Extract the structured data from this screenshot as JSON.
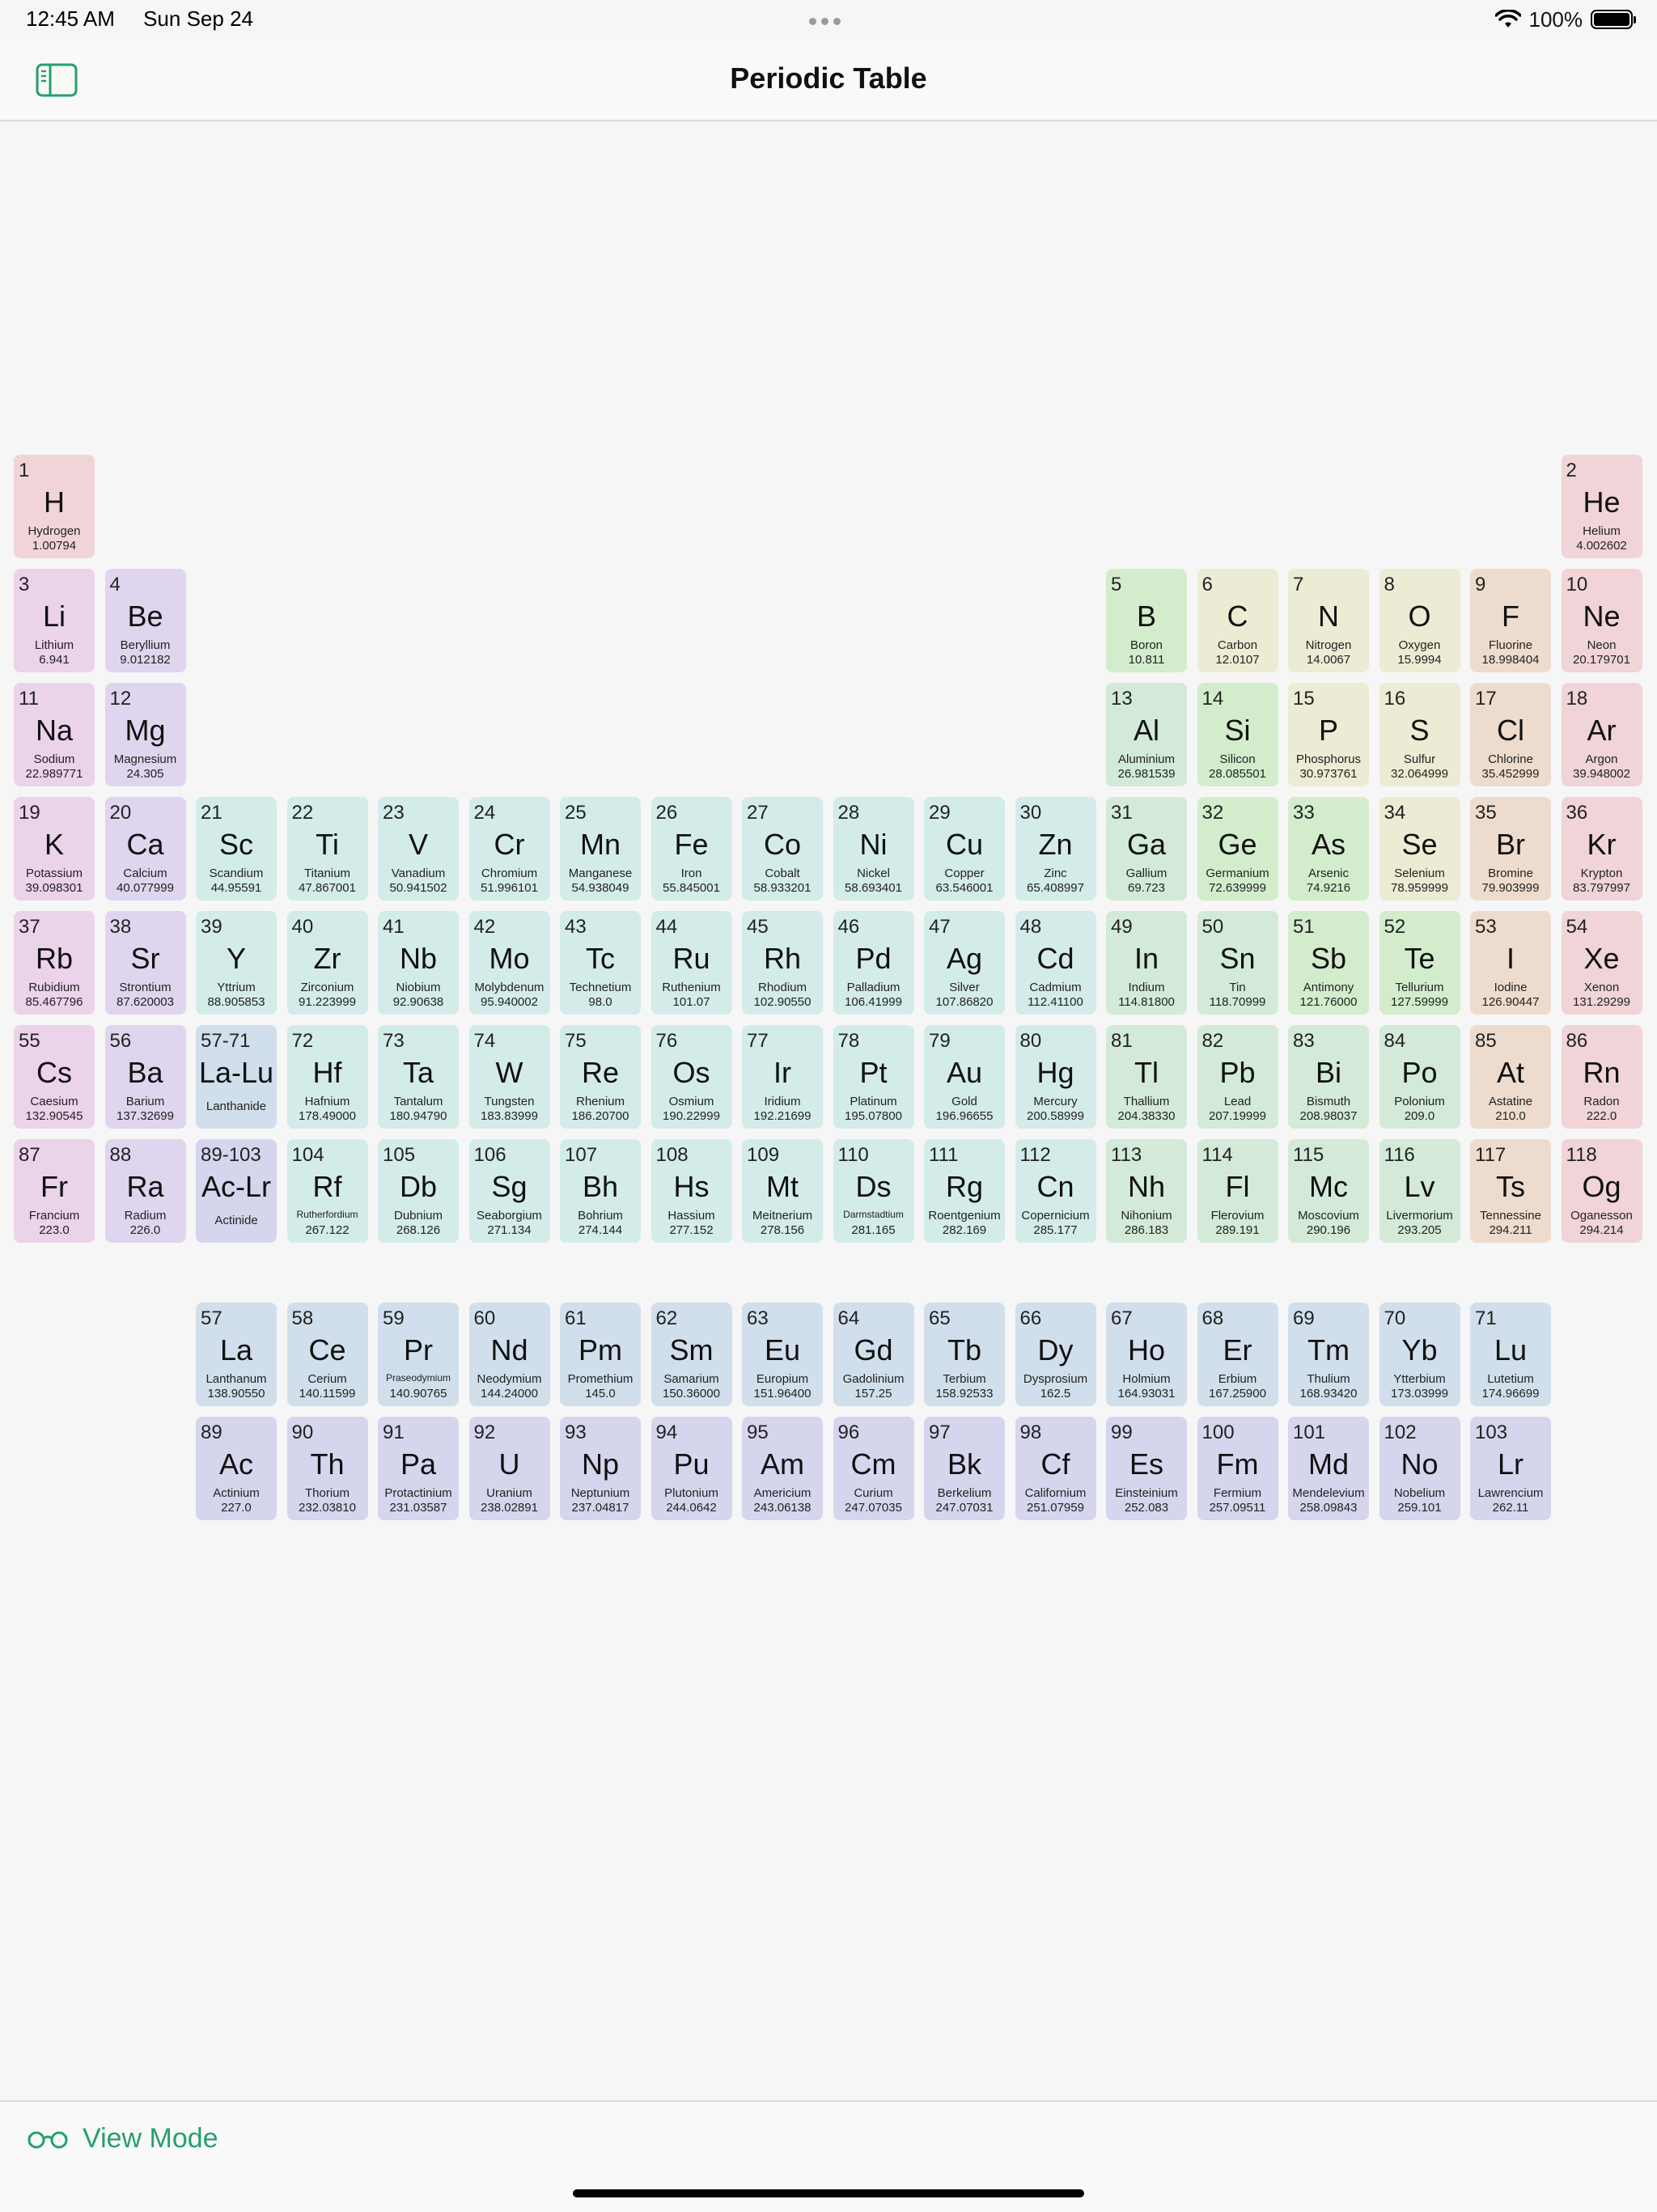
{
  "status_bar": {
    "time": "12:45 AM",
    "date": "Sun Sep 24",
    "battery": "100%"
  },
  "nav": {
    "title": "Periodic Table"
  },
  "footer": {
    "view_mode_label": "View Mode"
  },
  "colors": {
    "alkali": "#ebd3ea",
    "alkaline": "#e0d5ef",
    "transition": "#d3ece9",
    "post": "#d3ead8",
    "metalloid": "#d3edcc",
    "nonmetal": "#ececd4",
    "halogen": "#eddcce",
    "noble": "#f0d4d8",
    "lanthanide": "#d1dfec",
    "actinide": "#d6d5ee",
    "accent": "#26a06a"
  },
  "elements": [
    {
      "n": "1",
      "s": "H",
      "name": "Hydrogen",
      "m": "1.00794",
      "r": 1,
      "c": 1,
      "cat": "noble"
    },
    {
      "n": "2",
      "s": "He",
      "name": "Helium",
      "m": "4.002602",
      "r": 1,
      "c": 18,
      "cat": "noble"
    },
    {
      "n": "3",
      "s": "Li",
      "name": "Lithium",
      "m": "6.941",
      "r": 2,
      "c": 1,
      "cat": "alkali"
    },
    {
      "n": "4",
      "s": "Be",
      "name": "Beryllium",
      "m": "9.012182",
      "r": 2,
      "c": 2,
      "cat": "alkaline"
    },
    {
      "n": "5",
      "s": "B",
      "name": "Boron",
      "m": "10.811",
      "r": 2,
      "c": 13,
      "cat": "metalloid"
    },
    {
      "n": "6",
      "s": "C",
      "name": "Carbon",
      "m": "12.0107",
      "r": 2,
      "c": 14,
      "cat": "nonmetal"
    },
    {
      "n": "7",
      "s": "N",
      "name": "Nitrogen",
      "m": "14.0067",
      "r": 2,
      "c": 15,
      "cat": "nonmetal"
    },
    {
      "n": "8",
      "s": "O",
      "name": "Oxygen",
      "m": "15.9994",
      "r": 2,
      "c": 16,
      "cat": "nonmetal"
    },
    {
      "n": "9",
      "s": "F",
      "name": "Fluorine",
      "m": "18.998404",
      "r": 2,
      "c": 17,
      "cat": "halogen"
    },
    {
      "n": "10",
      "s": "Ne",
      "name": "Neon",
      "m": "20.179701",
      "r": 2,
      "c": 18,
      "cat": "noble"
    },
    {
      "n": "11",
      "s": "Na",
      "name": "Sodium",
      "m": "22.989771",
      "r": 3,
      "c": 1,
      "cat": "alkali"
    },
    {
      "n": "12",
      "s": "Mg",
      "name": "Magnesium",
      "m": "24.305",
      "r": 3,
      "c": 2,
      "cat": "alkaline"
    },
    {
      "n": "13",
      "s": "Al",
      "name": "Aluminium",
      "m": "26.981539",
      "r": 3,
      "c": 13,
      "cat": "post"
    },
    {
      "n": "14",
      "s": "Si",
      "name": "Silicon",
      "m": "28.085501",
      "r": 3,
      "c": 14,
      "cat": "metalloid"
    },
    {
      "n": "15",
      "s": "P",
      "name": "Phosphorus",
      "m": "30.973761",
      "r": 3,
      "c": 15,
      "cat": "nonmetal"
    },
    {
      "n": "16",
      "s": "S",
      "name": "Sulfur",
      "m": "32.064999",
      "r": 3,
      "c": 16,
      "cat": "nonmetal"
    },
    {
      "n": "17",
      "s": "Cl",
      "name": "Chlorine",
      "m": "35.452999",
      "r": 3,
      "c": 17,
      "cat": "halogen"
    },
    {
      "n": "18",
      "s": "Ar",
      "name": "Argon",
      "m": "39.948002",
      "r": 3,
      "c": 18,
      "cat": "noble"
    },
    {
      "n": "19",
      "s": "K",
      "name": "Potassium",
      "m": "39.098301",
      "r": 4,
      "c": 1,
      "cat": "alkali"
    },
    {
      "n": "20",
      "s": "Ca",
      "name": "Calcium",
      "m": "40.077999",
      "r": 4,
      "c": 2,
      "cat": "alkaline"
    },
    {
      "n": "21",
      "s": "Sc",
      "name": "Scandium",
      "m": "44.95591",
      "r": 4,
      "c": 3,
      "cat": "transition"
    },
    {
      "n": "22",
      "s": "Ti",
      "name": "Titanium",
      "m": "47.867001",
      "r": 4,
      "c": 4,
      "cat": "transition"
    },
    {
      "n": "23",
      "s": "V",
      "name": "Vanadium",
      "m": "50.941502",
      "r": 4,
      "c": 5,
      "cat": "transition"
    },
    {
      "n": "24",
      "s": "Cr",
      "name": "Chromium",
      "m": "51.996101",
      "r": 4,
      "c": 6,
      "cat": "transition"
    },
    {
      "n": "25",
      "s": "Mn",
      "name": "Manganese",
      "m": "54.938049",
      "r": 4,
      "c": 7,
      "cat": "transition"
    },
    {
      "n": "26",
      "s": "Fe",
      "name": "Iron",
      "m": "55.845001",
      "r": 4,
      "c": 8,
      "cat": "transition"
    },
    {
      "n": "27",
      "s": "Co",
      "name": "Cobalt",
      "m": "58.933201",
      "r": 4,
      "c": 9,
      "cat": "transition"
    },
    {
      "n": "28",
      "s": "Ni",
      "name": "Nickel",
      "m": "58.693401",
      "r": 4,
      "c": 10,
      "cat": "transition"
    },
    {
      "n": "29",
      "s": "Cu",
      "name": "Copper",
      "m": "63.546001",
      "r": 4,
      "c": 11,
      "cat": "transition"
    },
    {
      "n": "30",
      "s": "Zn",
      "name": "Zinc",
      "m": "65.408997",
      "r": 4,
      "c": 12,
      "cat": "transition"
    },
    {
      "n": "31",
      "s": "Ga",
      "name": "Gallium",
      "m": "69.723",
      "r": 4,
      "c": 13,
      "cat": "post"
    },
    {
      "n": "32",
      "s": "Ge",
      "name": "Germanium",
      "m": "72.639999",
      "r": 4,
      "c": 14,
      "cat": "metalloid"
    },
    {
      "n": "33",
      "s": "As",
      "name": "Arsenic",
      "m": "74.9216",
      "r": 4,
      "c": 15,
      "cat": "metalloid"
    },
    {
      "n": "34",
      "s": "Se",
      "name": "Selenium",
      "m": "78.959999",
      "r": 4,
      "c": 16,
      "cat": "nonmetal"
    },
    {
      "n": "35",
      "s": "Br",
      "name": "Bromine",
      "m": "79.903999",
      "r": 4,
      "c": 17,
      "cat": "halogen"
    },
    {
      "n": "36",
      "s": "Kr",
      "name": "Krypton",
      "m": "83.797997",
      "r": 4,
      "c": 18,
      "cat": "noble"
    },
    {
      "n": "37",
      "s": "Rb",
      "name": "Rubidium",
      "m": "85.467796",
      "r": 5,
      "c": 1,
      "cat": "alkali"
    },
    {
      "n": "38",
      "s": "Sr",
      "name": "Strontium",
      "m": "87.620003",
      "r": 5,
      "c": 2,
      "cat": "alkaline"
    },
    {
      "n": "39",
      "s": "Y",
      "name": "Yttrium",
      "m": "88.905853",
      "r": 5,
      "c": 3,
      "cat": "transition"
    },
    {
      "n": "40",
      "s": "Zr",
      "name": "Zirconium",
      "m": "91.223999",
      "r": 5,
      "c": 4,
      "cat": "transition"
    },
    {
      "n": "41",
      "s": "Nb",
      "name": "Niobium",
      "m": "92.90638",
      "r": 5,
      "c": 5,
      "cat": "transition"
    },
    {
      "n": "42",
      "s": "Mo",
      "name": "Molybdenum",
      "m": "95.940002",
      "r": 5,
      "c": 6,
      "cat": "transition"
    },
    {
      "n": "43",
      "s": "Tc",
      "name": "Technetium",
      "m": "98.0",
      "r": 5,
      "c": 7,
      "cat": "transition"
    },
    {
      "n": "44",
      "s": "Ru",
      "name": "Ruthenium",
      "m": "101.07",
      "r": 5,
      "c": 8,
      "cat": "transition"
    },
    {
      "n": "45",
      "s": "Rh",
      "name": "Rhodium",
      "m": "102.90550",
      "r": 5,
      "c": 9,
      "cat": "transition"
    },
    {
      "n": "46",
      "s": "Pd",
      "name": "Palladium",
      "m": "106.41999",
      "r": 5,
      "c": 10,
      "cat": "transition"
    },
    {
      "n": "47",
      "s": "Ag",
      "name": "Silver",
      "m": "107.86820",
      "r": 5,
      "c": 11,
      "cat": "transition"
    },
    {
      "n": "48",
      "s": "Cd",
      "name": "Cadmium",
      "m": "112.41100",
      "r": 5,
      "c": 12,
      "cat": "transition"
    },
    {
      "n": "49",
      "s": "In",
      "name": "Indium",
      "m": "114.81800",
      "r": 5,
      "c": 13,
      "cat": "post"
    },
    {
      "n": "50",
      "s": "Sn",
      "name": "Tin",
      "m": "118.70999",
      "r": 5,
      "c": 14,
      "cat": "post"
    },
    {
      "n": "51",
      "s": "Sb",
      "name": "Antimony",
      "m": "121.76000",
      "r": 5,
      "c": 15,
      "cat": "metalloid"
    },
    {
      "n": "52",
      "s": "Te",
      "name": "Tellurium",
      "m": "127.59999",
      "r": 5,
      "c": 16,
      "cat": "metalloid"
    },
    {
      "n": "53",
      "s": "I",
      "name": "Iodine",
      "m": "126.90447",
      "r": 5,
      "c": 17,
      "cat": "halogen"
    },
    {
      "n": "54",
      "s": "Xe",
      "name": "Xenon",
      "m": "131.29299",
      "r": 5,
      "c": 18,
      "cat": "noble"
    },
    {
      "n": "55",
      "s": "Cs",
      "name": "Caesium",
      "m": "132.90545",
      "r": 6,
      "c": 1,
      "cat": "alkali"
    },
    {
      "n": "56",
      "s": "Ba",
      "name": "Barium",
      "m": "137.32699",
      "r": 6,
      "c": 2,
      "cat": "alkaline"
    },
    {
      "n": "57-71",
      "s": "La-Lu",
      "name": "",
      "m": "Lanthanide",
      "r": 6,
      "c": 3,
      "cat": "lanthanide"
    },
    {
      "n": "72",
      "s": "Hf",
      "name": "Hafnium",
      "m": "178.49000",
      "r": 6,
      "c": 4,
      "cat": "transition"
    },
    {
      "n": "73",
      "s": "Ta",
      "name": "Tantalum",
      "m": "180.94790",
      "r": 6,
      "c": 5,
      "cat": "transition"
    },
    {
      "n": "74",
      "s": "W",
      "name": "Tungsten",
      "m": "183.83999",
      "r": 6,
      "c": 6,
      "cat": "transition"
    },
    {
      "n": "75",
      "s": "Re",
      "name": "Rhenium",
      "m": "186.20700",
      "r": 6,
      "c": 7,
      "cat": "transition"
    },
    {
      "n": "76",
      "s": "Os",
      "name": "Osmium",
      "m": "190.22999",
      "r": 6,
      "c": 8,
      "cat": "transition"
    },
    {
      "n": "77",
      "s": "Ir",
      "name": "Iridium",
      "m": "192.21699",
      "r": 6,
      "c": 9,
      "cat": "transition"
    },
    {
      "n": "78",
      "s": "Pt",
      "name": "Platinum",
      "m": "195.07800",
      "r": 6,
      "c": 10,
      "cat": "transition"
    },
    {
      "n": "79",
      "s": "Au",
      "name": "Gold",
      "m": "196.96655",
      "r": 6,
      "c": 11,
      "cat": "transition"
    },
    {
      "n": "80",
      "s": "Hg",
      "name": "Mercury",
      "m": "200.58999",
      "r": 6,
      "c": 12,
      "cat": "transition"
    },
    {
      "n": "81",
      "s": "Tl",
      "name": "Thallium",
      "m": "204.38330",
      "r": 6,
      "c": 13,
      "cat": "post"
    },
    {
      "n": "82",
      "s": "Pb",
      "name": "Lead",
      "m": "207.19999",
      "r": 6,
      "c": 14,
      "cat": "post"
    },
    {
      "n": "83",
      "s": "Bi",
      "name": "Bismuth",
      "m": "208.98037",
      "r": 6,
      "c": 15,
      "cat": "post"
    },
    {
      "n": "84",
      "s": "Po",
      "name": "Polonium",
      "m": "209.0",
      "r": 6,
      "c": 16,
      "cat": "post"
    },
    {
      "n": "85",
      "s": "At",
      "name": "Astatine",
      "m": "210.0",
      "r": 6,
      "c": 17,
      "cat": "halogen"
    },
    {
      "n": "86",
      "s": "Rn",
      "name": "Radon",
      "m": "222.0",
      "r": 6,
      "c": 18,
      "cat": "noble"
    },
    {
      "n": "87",
      "s": "Fr",
      "name": "Francium",
      "m": "223.0",
      "r": 7,
      "c": 1,
      "cat": "alkali"
    },
    {
      "n": "88",
      "s": "Ra",
      "name": "Radium",
      "m": "226.0",
      "r": 7,
      "c": 2,
      "cat": "alkaline"
    },
    {
      "n": "89-103",
      "s": "Ac-Lr",
      "name": "",
      "m": "Actinide",
      "r": 7,
      "c": 3,
      "cat": "actinide"
    },
    {
      "n": "104",
      "s": "Rf",
      "name": "Rutherfordium",
      "m": "267.122",
      "r": 7,
      "c": 4,
      "cat": "transition",
      "small": true
    },
    {
      "n": "105",
      "s": "Db",
      "name": "Dubnium",
      "m": "268.126",
      "r": 7,
      "c": 5,
      "cat": "transition"
    },
    {
      "n": "106",
      "s": "Sg",
      "name": "Seaborgium",
      "m": "271.134",
      "r": 7,
      "c": 6,
      "cat": "transition"
    },
    {
      "n": "107",
      "s": "Bh",
      "name": "Bohrium",
      "m": "274.144",
      "r": 7,
      "c": 7,
      "cat": "transition"
    },
    {
      "n": "108",
      "s": "Hs",
      "name": "Hassium",
      "m": "277.152",
      "r": 7,
      "c": 8,
      "cat": "transition"
    },
    {
      "n": "109",
      "s": "Mt",
      "name": "Meitnerium",
      "m": "278.156",
      "r": 7,
      "c": 9,
      "cat": "transition"
    },
    {
      "n": "110",
      "s": "Ds",
      "name": "Darmstadtium",
      "m": "281.165",
      "r": 7,
      "c": 10,
      "cat": "transition",
      "small": true
    },
    {
      "n": "111",
      "s": "Rg",
      "name": "Roentgenium",
      "m": "282.169",
      "r": 7,
      "c": 11,
      "cat": "transition"
    },
    {
      "n": "112",
      "s": "Cn",
      "name": "Copernicium",
      "m": "285.177",
      "r": 7,
      "c": 12,
      "cat": "transition"
    },
    {
      "n": "113",
      "s": "Nh",
      "name": "Nihonium",
      "m": "286.183",
      "r": 7,
      "c": 13,
      "cat": "post"
    },
    {
      "n": "114",
      "s": "Fl",
      "name": "Flerovium",
      "m": "289.191",
      "r": 7,
      "c": 14,
      "cat": "post"
    },
    {
      "n": "115",
      "s": "Mc",
      "name": "Moscovium",
      "m": "290.196",
      "r": 7,
      "c": 15,
      "cat": "post"
    },
    {
      "n": "116",
      "s": "Lv",
      "name": "Livermorium",
      "m": "293.205",
      "r": 7,
      "c": 16,
      "cat": "post"
    },
    {
      "n": "117",
      "s": "Ts",
      "name": "Tennessine",
      "m": "294.211",
      "r": 7,
      "c": 17,
      "cat": "halogen"
    },
    {
      "n": "118",
      "s": "Og",
      "name": "Oganesson",
      "m": "294.214",
      "r": 7,
      "c": 18,
      "cat": "noble"
    },
    {
      "n": "57",
      "s": "La",
      "name": "Lanthanum",
      "m": "138.90550",
      "r": 9,
      "c": 3,
      "cat": "lanthanide"
    },
    {
      "n": "58",
      "s": "Ce",
      "name": "Cerium",
      "m": "140.11599",
      "r": 9,
      "c": 4,
      "cat": "lanthanide"
    },
    {
      "n": "59",
      "s": "Pr",
      "name": "Praseodymium",
      "m": "140.90765",
      "r": 9,
      "c": 5,
      "cat": "lanthanide",
      "small": true
    },
    {
      "n": "60",
      "s": "Nd",
      "name": "Neodymium",
      "m": "144.24000",
      "r": 9,
      "c": 6,
      "cat": "lanthanide"
    },
    {
      "n": "61",
      "s": "Pm",
      "name": "Promethium",
      "m": "145.0",
      "r": 9,
      "c": 7,
      "cat": "lanthanide"
    },
    {
      "n": "62",
      "s": "Sm",
      "name": "Samarium",
      "m": "150.36000",
      "r": 9,
      "c": 8,
      "cat": "lanthanide"
    },
    {
      "n": "63",
      "s": "Eu",
      "name": "Europium",
      "m": "151.96400",
      "r": 9,
      "c": 9,
      "cat": "lanthanide"
    },
    {
      "n": "64",
      "s": "Gd",
      "name": "Gadolinium",
      "m": "157.25",
      "r": 9,
      "c": 10,
      "cat": "lanthanide"
    },
    {
      "n": "65",
      "s": "Tb",
      "name": "Terbium",
      "m": "158.92533",
      "r": 9,
      "c": 11,
      "cat": "lanthanide"
    },
    {
      "n": "66",
      "s": "Dy",
      "name": "Dysprosium",
      "m": "162.5",
      "r": 9,
      "c": 12,
      "cat": "lanthanide"
    },
    {
      "n": "67",
      "s": "Ho",
      "name": "Holmium",
      "m": "164.93031",
      "r": 9,
      "c": 13,
      "cat": "lanthanide"
    },
    {
      "n": "68",
      "s": "Er",
      "name": "Erbium",
      "m": "167.25900",
      "r": 9,
      "c": 14,
      "cat": "lanthanide"
    },
    {
      "n": "69",
      "s": "Tm",
      "name": "Thulium",
      "m": "168.93420",
      "r": 9,
      "c": 15,
      "cat": "lanthanide"
    },
    {
      "n": "70",
      "s": "Yb",
      "name": "Ytterbium",
      "m": "173.03999",
      "r": 9,
      "c": 16,
      "cat": "lanthanide"
    },
    {
      "n": "71",
      "s": "Lu",
      "name": "Lutetium",
      "m": "174.96699",
      "r": 9,
      "c": 17,
      "cat": "lanthanide"
    },
    {
      "n": "89",
      "s": "Ac",
      "name": "Actinium",
      "m": "227.0",
      "r": 10,
      "c": 3,
      "cat": "actinide"
    },
    {
      "n": "90",
      "s": "Th",
      "name": "Thorium",
      "m": "232.03810",
      "r": 10,
      "c": 4,
      "cat": "actinide"
    },
    {
      "n": "91",
      "s": "Pa",
      "name": "Protactinium",
      "m": "231.03587",
      "r": 10,
      "c": 5,
      "cat": "actinide"
    },
    {
      "n": "92",
      "s": "U",
      "name": "Uranium",
      "m": "238.02891",
      "r": 10,
      "c": 6,
      "cat": "actinide"
    },
    {
      "n": "93",
      "s": "Np",
      "name": "Neptunium",
      "m": "237.04817",
      "r": 10,
      "c": 7,
      "cat": "actinide"
    },
    {
      "n": "94",
      "s": "Pu",
      "name": "Plutonium",
      "m": "244.0642",
      "r": 10,
      "c": 8,
      "cat": "actinide"
    },
    {
      "n": "95",
      "s": "Am",
      "name": "Americium",
      "m": "243.06138",
      "r": 10,
      "c": 9,
      "cat": "actinide"
    },
    {
      "n": "96",
      "s": "Cm",
      "name": "Curium",
      "m": "247.07035",
      "r": 10,
      "c": 10,
      "cat": "actinide"
    },
    {
      "n": "97",
      "s": "Bk",
      "name": "Berkelium",
      "m": "247.07031",
      "r": 10,
      "c": 11,
      "cat": "actinide"
    },
    {
      "n": "98",
      "s": "Cf",
      "name": "Californium",
      "m": "251.07959",
      "r": 10,
      "c": 12,
      "cat": "actinide"
    },
    {
      "n": "99",
      "s": "Es",
      "name": "Einsteinium",
      "m": "252.083",
      "r": 10,
      "c": 13,
      "cat": "actinide"
    },
    {
      "n": "100",
      "s": "Fm",
      "name": "Fermium",
      "m": "257.09511",
      "r": 10,
      "c": 14,
      "cat": "actinide"
    },
    {
      "n": "101",
      "s": "Md",
      "name": "Mendelevium",
      "m": "258.09843",
      "r": 10,
      "c": 15,
      "cat": "actinide"
    },
    {
      "n": "102",
      "s": "No",
      "name": "Nobelium",
      "m": "259.101",
      "r": 10,
      "c": 16,
      "cat": "actinide"
    },
    {
      "n": "103",
      "s": "Lr",
      "name": "Lawrencium",
      "m": "262.11",
      "r": 10,
      "c": 17,
      "cat": "actinide"
    }
  ]
}
